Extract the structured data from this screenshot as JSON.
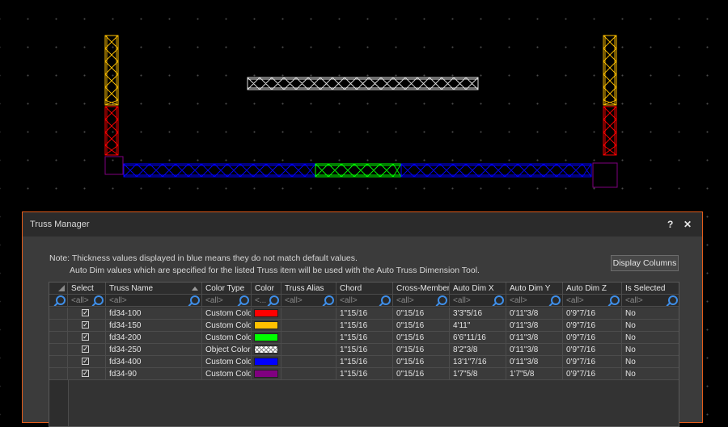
{
  "dialog": {
    "title": "Truss Manager",
    "help_label": "?",
    "close_label": "✕",
    "note_line1": "Note: Thickness values displayed in blue means they do not match default values.",
    "note_line2": "Auto Dim values which are specified for the listed Truss item will be used with the Auto Truss Dimension Tool.",
    "display_columns_label": "Display Columns"
  },
  "grid": {
    "columns": [
      "Select",
      "Truss Name",
      "Color Type",
      "Color",
      "Truss Alias",
      "Chord",
      "Cross-Member",
      "Auto Dim X",
      "Auto Dim Y",
      "Auto Dim Z",
      "Is Selected"
    ],
    "filter_text": "<all>",
    "filter_color_text": "<...",
    "rows": [
      {
        "name": "fd34-100",
        "color_type": "Custom Color",
        "color": "#ff0000",
        "chord": "1\"15/16",
        "cross": "0\"15/16",
        "dimx": "3'3\"5/16",
        "dimy": "0'11\"3/8",
        "dimz": "0'9\"7/16",
        "selected": "No"
      },
      {
        "name": "fd34-150",
        "color_type": "Custom Color",
        "color": "#ffc000",
        "chord": "1\"15/16",
        "cross": "0\"15/16",
        "dimx": "4'11\"",
        "dimy": "0'11\"3/8",
        "dimz": "0'9\"7/16",
        "selected": "No"
      },
      {
        "name": "fd34-200",
        "color_type": "Custom Color",
        "color": "#00ff00",
        "chord": "1\"15/16",
        "cross": "0\"15/16",
        "dimx": "6'6\"11/16",
        "dimy": "0'11\"3/8",
        "dimz": "0'9\"7/16",
        "selected": "No"
      },
      {
        "name": "fd34-250",
        "color_type": "Object Color",
        "color": "hatch",
        "chord": "1\"15/16",
        "cross": "0\"15/16",
        "dimx": "8'2\"3/8",
        "dimy": "0'11\"3/8",
        "dimz": "0'9\"7/16",
        "selected": "No"
      },
      {
        "name": "fd34-400",
        "color_type": "Custom Color",
        "color": "#0000ff",
        "chord": "1\"15/16",
        "cross": "0\"15/16",
        "dimx": "13'1\"7/16",
        "dimy": "0'11\"3/8",
        "dimz": "0'9\"7/16",
        "selected": "No"
      },
      {
        "name": "fd34-90",
        "color_type": "Custom Color",
        "color": "#800080",
        "chord": "1\"15/16",
        "cross": "0\"15/16",
        "dimx": "1'7\"5/8",
        "dimy": "1'7\"5/8",
        "dimz": "0'9\"7/16",
        "selected": "No"
      }
    ]
  },
  "colors": {
    "accent_border": "#e35d1b",
    "truss_red": "#ff0000",
    "truss_yellow": "#ffc000",
    "truss_green": "#00ff00",
    "truss_blue": "#0000ff",
    "truss_purple": "#800080",
    "truss_white": "#e0e0e0"
  },
  "icons": [
    "search-icon",
    "help-icon",
    "close-icon",
    "checkbox-icon",
    "sort-icon"
  ]
}
